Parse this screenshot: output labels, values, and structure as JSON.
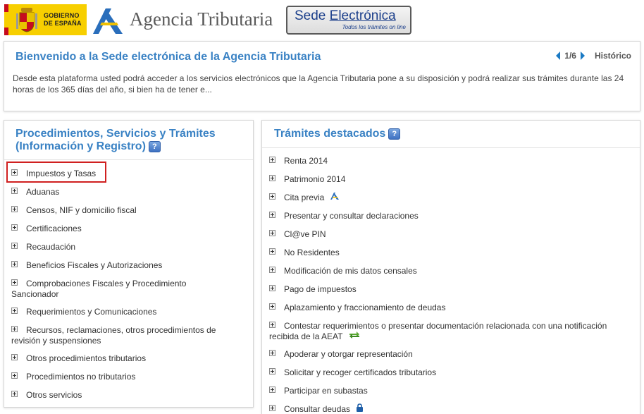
{
  "header": {
    "gov_text_line1": "GOBIERNO",
    "gov_text_line2": "DE ESPAÑA",
    "agency_name": "Agencia Tributaria",
    "sede_title_part1": "Sede ",
    "sede_title_part2": "Electrónica",
    "sede_subtitle": "Todos los trámites on line"
  },
  "welcome": {
    "title": "Bienvenido a la Sede electrónica de la Agencia Tributaria",
    "page_indicator": "1/6",
    "history_link": "Histórico",
    "body": "Desde esta plataforma usted podrá acceder a los servicios electrónicos que la Agencia Tributaria pone a su disposición y podrá realizar sus trámites durante las 24 horas de los 365 días del año, si bien ha de tener e..."
  },
  "procedures": {
    "title": "Procedimientos, Servicios y Trámites (Información y Registro)",
    "help_label": "?",
    "items": [
      "Impuestos y Tasas",
      "Aduanas",
      "Censos, NIF y domicilio fiscal",
      "Certificaciones",
      "Recaudación",
      "Beneficios Fiscales y Autorizaciones",
      "Comprobaciones Fiscales y Procedimiento Sancionador",
      "Requerimientos y Comunicaciones",
      "Recursos, reclamaciones, otros procedimientos de revisión y suspensiones",
      "Otros procedimientos tributarios",
      "Procedimientos no tributarios",
      "Otros servicios"
    ]
  },
  "featured": {
    "title": "Trámites destacados",
    "help_label": "?",
    "items": [
      "Renta 2014",
      "Patrimonio 2014",
      "Cita previa",
      "Presentar y consultar declaraciones",
      "Cl@ve PIN",
      "No Residentes",
      "Modificación de mis datos censales",
      "Pago de impuestos",
      "Aplazamiento y fraccionamiento de deudas",
      "Contestar requerimientos o presentar documentación relacionada con una notificación recibida de la AEAT",
      "Apoderar y otorgar representación",
      "Solicitar y recoger certificados tributarios",
      "Participar en subastas",
      "Consultar deudas"
    ]
  },
  "colors": {
    "title_blue": "#3a82c4",
    "highlight_red": "#d02020",
    "nav_arrow_blue": "#1a7ac4"
  }
}
